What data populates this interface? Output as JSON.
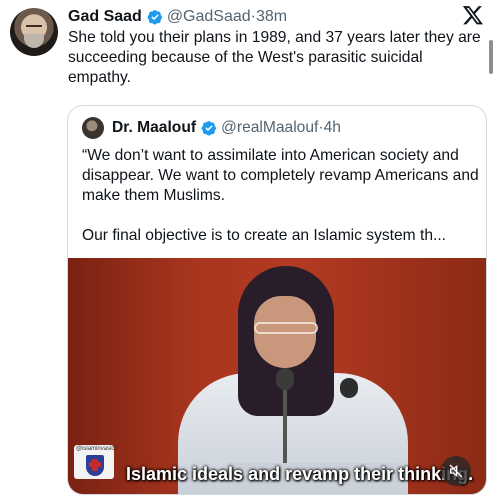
{
  "author": {
    "name": "Gad Saad",
    "handle": "@GadSaad",
    "separator": "·",
    "time": "38m",
    "verified_color": "#1d9bf0"
  },
  "tweet": {
    "text": "She told you their plans in 1989, and 37 years later they are succeeding because of the West's parasitic suicidal empathy."
  },
  "quoted": {
    "name": "Dr. Maalouf",
    "handle": "@realMaalouf",
    "separator": "·",
    "time": "4h",
    "text": "“We don’t want to assimilate into American society and disappear. We want to completely revamp Americans and make them Muslims.\n\nOur final objective is to create an Islamic system th...",
    "video": {
      "watermark": "@islaminvasion",
      "caption": "Islamic ideals and revamp their thinking."
    }
  },
  "icons": {
    "x_logo": "x-logo-icon",
    "verified": "verified-badge-icon",
    "mute": "muted-speaker-icon"
  }
}
